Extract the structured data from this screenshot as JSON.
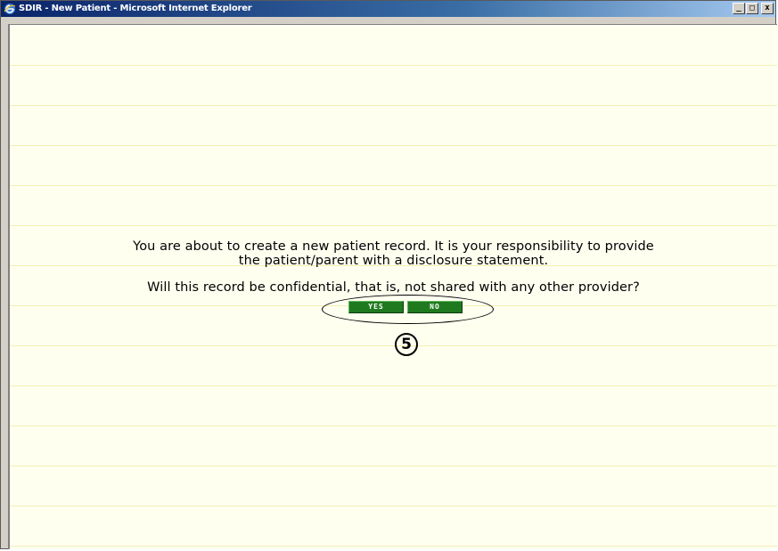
{
  "window": {
    "title": "SDIR - New Patient - Microsoft Internet Explorer",
    "controls": {
      "minimize": "_",
      "maximize": "□",
      "close": "x"
    }
  },
  "dialog": {
    "line1": "You are about to create a new patient record. It is your responsibility to provide",
    "line2": "the patient/parent with a disclosure statement.",
    "question": "Will this record be confidential, that is, not shared with any other provider?",
    "yes_label": "YES",
    "no_label": "NO"
  },
  "annotation": {
    "number": "5"
  },
  "colors": {
    "background": "#fffff0",
    "rule_lines": "#f2efb4",
    "button": "#1f7a1f",
    "titlebar": "#0a246a"
  },
  "icons": [
    "ie-icon",
    "minimize-icon",
    "maximize-icon",
    "close-icon"
  ]
}
